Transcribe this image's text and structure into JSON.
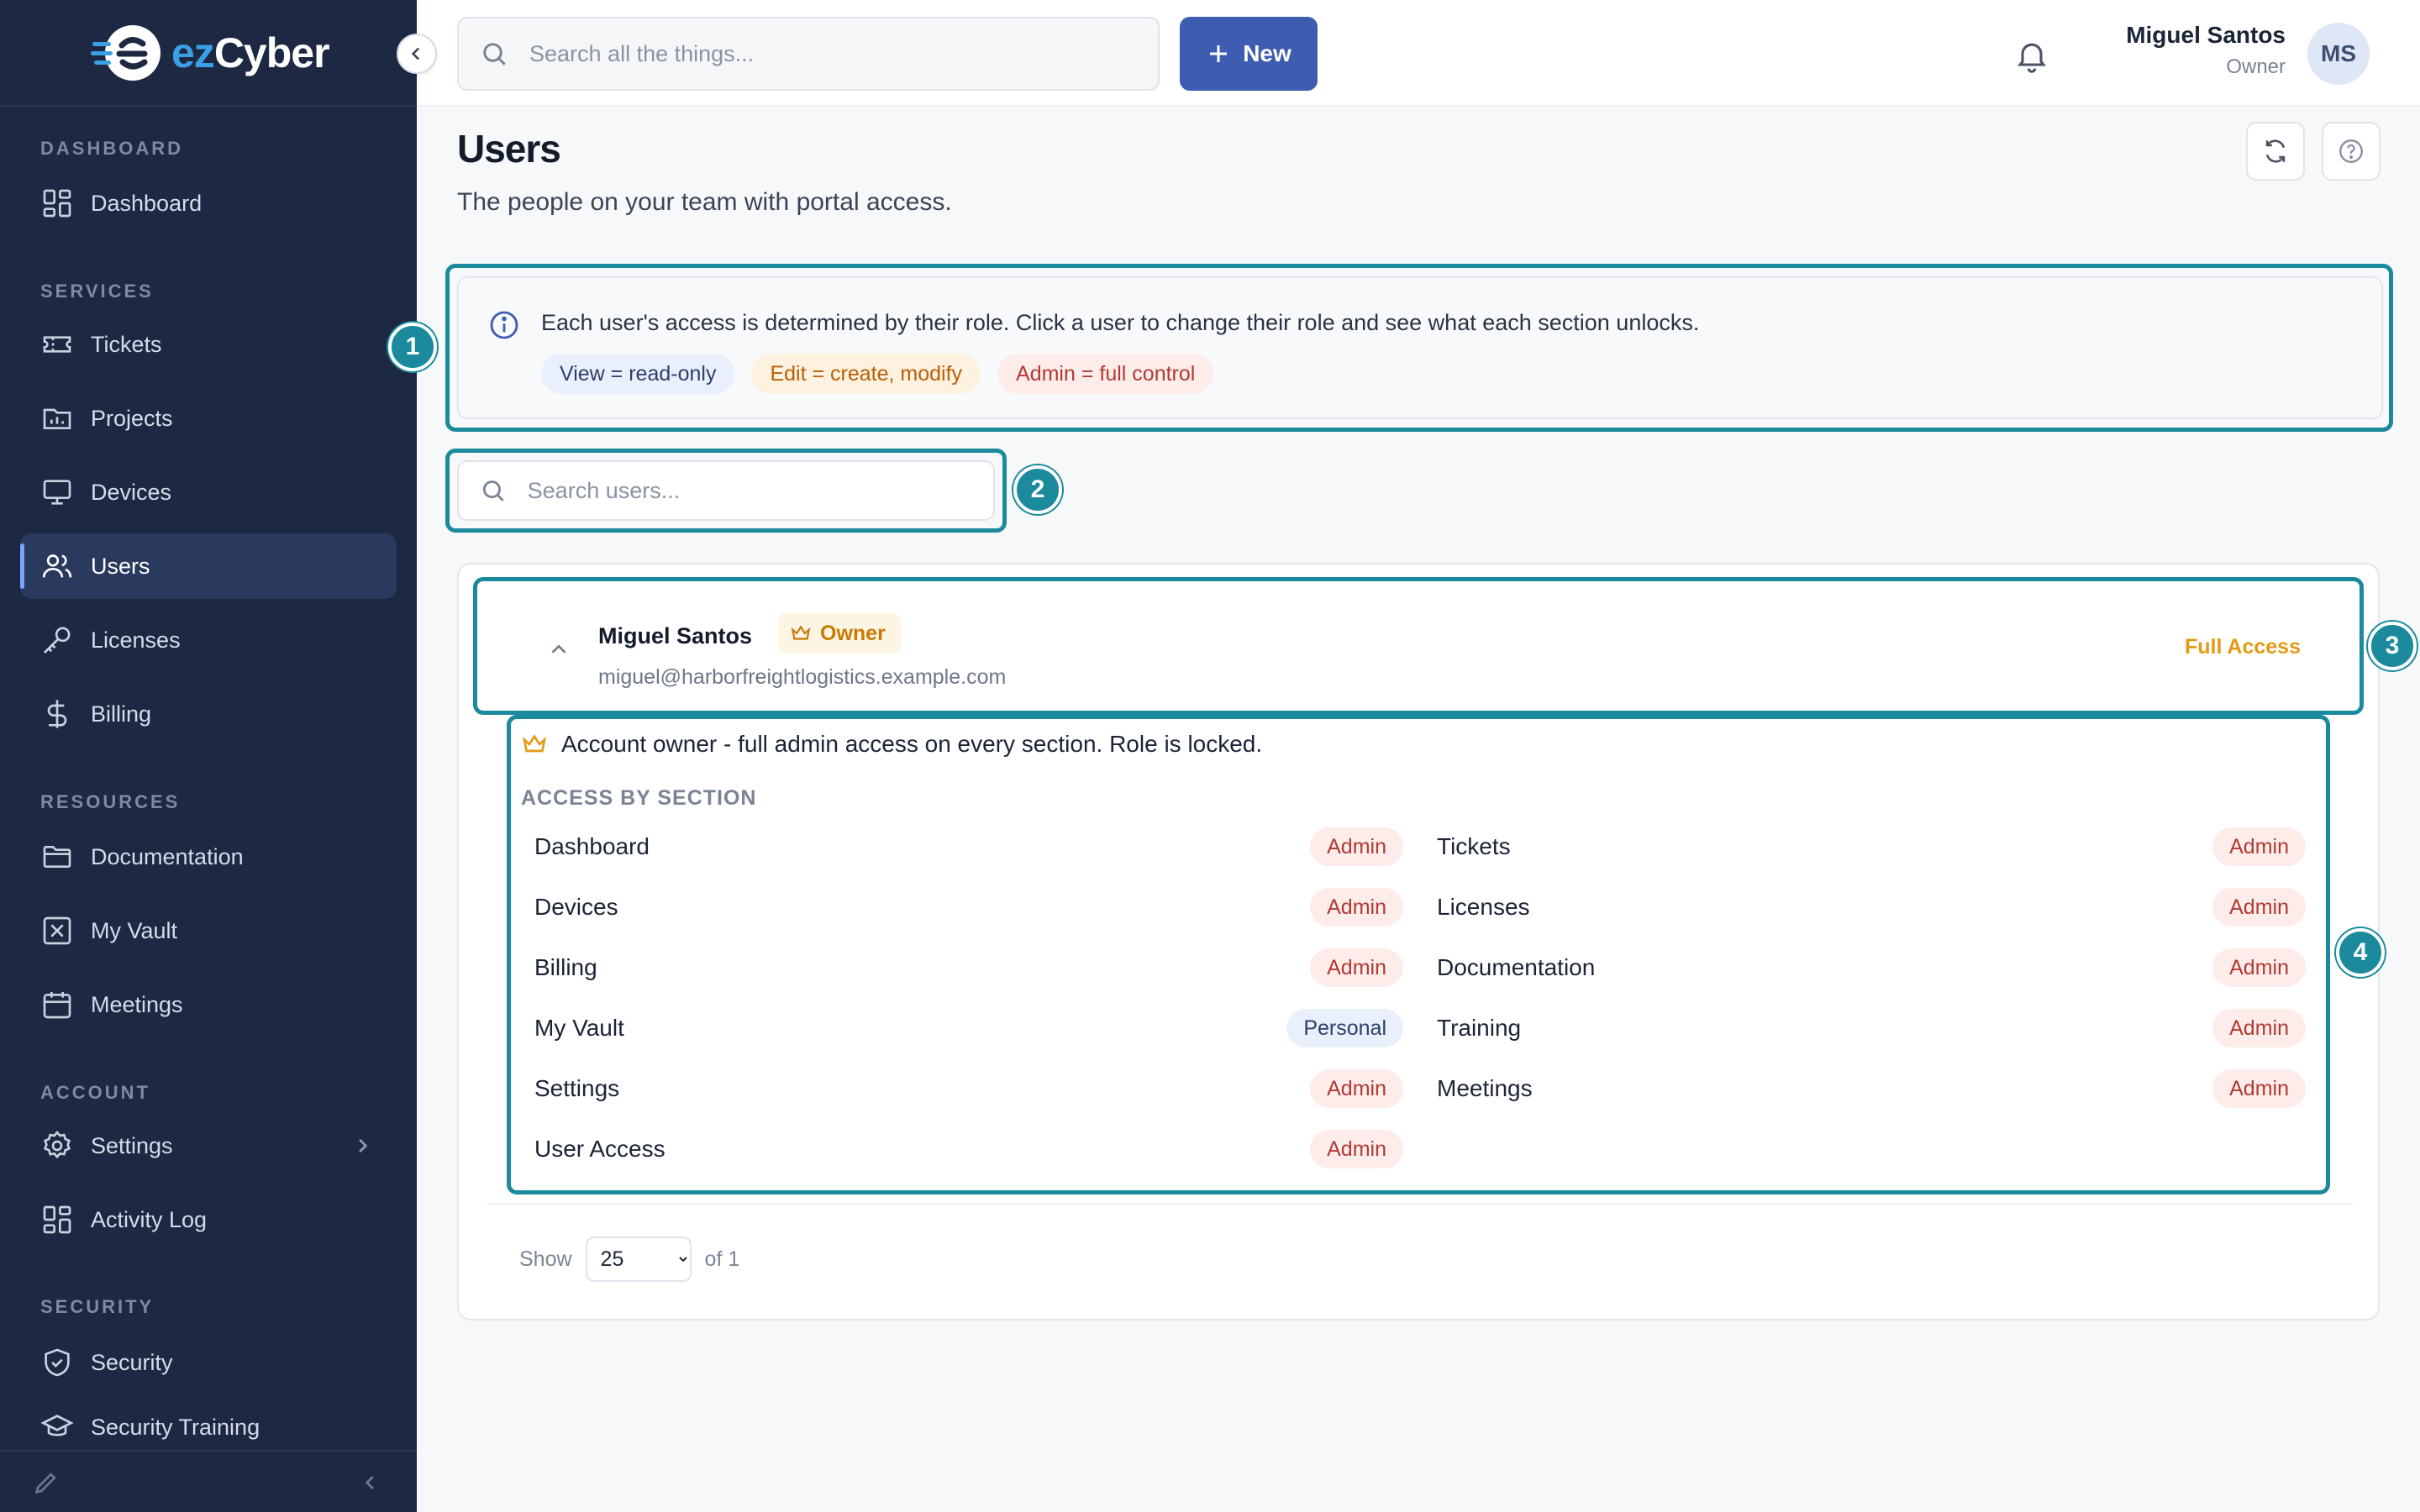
{
  "brand": {
    "logo_text_ez": "ez",
    "logo_text_cyber": "Cyber",
    "accent": "#3f5db0",
    "highlight": "#1a8a9c"
  },
  "sidebar": {
    "sections": {
      "dashboard": "DASHBOARD",
      "services": "SERVICES",
      "resources": "RESOURCES",
      "account": "ACCOUNT",
      "security": "SECURITY"
    },
    "items": [
      {
        "label": "Dashboard",
        "icon": "dashboard-icon"
      },
      {
        "label": "Tickets",
        "icon": "ticket-icon"
      },
      {
        "label": "Projects",
        "icon": "projects-icon"
      },
      {
        "label": "Devices",
        "icon": "monitor-icon"
      },
      {
        "label": "Users",
        "icon": "users-icon",
        "active": true
      },
      {
        "label": "Licenses",
        "icon": "key-icon"
      },
      {
        "label": "Billing",
        "icon": "dollar-icon"
      },
      {
        "label": "Documentation",
        "icon": "folder-icon"
      },
      {
        "label": "My Vault",
        "icon": "vault-icon"
      },
      {
        "label": "Meetings",
        "icon": "calendar-icon"
      },
      {
        "label": "Settings",
        "icon": "gear-icon"
      },
      {
        "label": "Activity Log",
        "icon": "activity-icon"
      },
      {
        "label": "Security",
        "icon": "shield-icon"
      },
      {
        "label": "Security Training",
        "icon": "graduation-icon"
      }
    ]
  },
  "header": {
    "search_placeholder": "Search all the things...",
    "new_label": "New",
    "user_name": "Miguel Santos",
    "user_role": "Owner",
    "avatar_initials": "MS"
  },
  "page": {
    "title": "Users",
    "subtitle": "The people on your team with portal access."
  },
  "info": {
    "text": "Each user's access is determined by their role. Click a user to change their role and see what each section unlocks.",
    "chips": {
      "view": "View = read-only",
      "edit": "Edit = create, modify",
      "admin": "Admin = full control"
    }
  },
  "user_search": {
    "placeholder": "Search users..."
  },
  "user": {
    "name": "Miguel Santos",
    "badge": "Owner",
    "email": "miguel@harborfreightlogistics.example.com",
    "access_summary": "Full Access",
    "owner_note": "Account owner - full admin access on every section. Role is locked.",
    "access_heading": "ACCESS BY SECTION",
    "sections": [
      {
        "name": "Dashboard",
        "level": "Admin"
      },
      {
        "name": "Tickets",
        "level": "Admin"
      },
      {
        "name": "Devices",
        "level": "Admin"
      },
      {
        "name": "Licenses",
        "level": "Admin"
      },
      {
        "name": "Billing",
        "level": "Admin"
      },
      {
        "name": "Documentation",
        "level": "Admin"
      },
      {
        "name": "My Vault",
        "level": "Personal"
      },
      {
        "name": "Training",
        "level": "Admin"
      },
      {
        "name": "Settings",
        "level": "Admin"
      },
      {
        "name": "Meetings",
        "level": "Admin"
      },
      {
        "name": "User Access",
        "level": "Admin"
      }
    ]
  },
  "pager": {
    "show_label": "Show",
    "page_size": "25",
    "of_label": "of 1"
  },
  "markers": [
    "1",
    "2",
    "3",
    "4"
  ]
}
